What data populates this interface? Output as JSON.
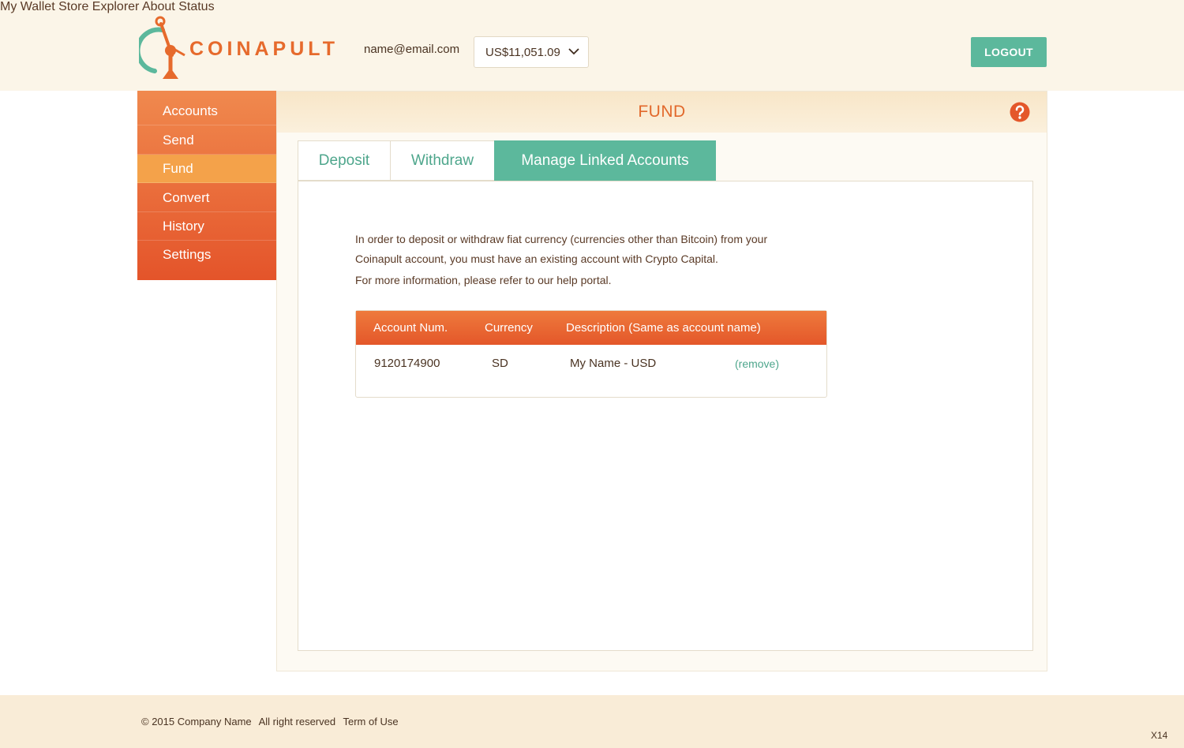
{
  "header": {
    "brand": "COINAPULT",
    "user_email": "name@email.com",
    "balance": "US$11,051.09",
    "nav": [
      "My Wallet",
      "Store",
      "Explorer",
      "About",
      "Status"
    ],
    "logout_label": "LOGOUT"
  },
  "sidebar": {
    "items": [
      {
        "label": "Accounts"
      },
      {
        "label": "Send"
      },
      {
        "label": "Fund",
        "active": true
      },
      {
        "label": "Convert"
      },
      {
        "label": "History"
      },
      {
        "label": "Settings"
      }
    ]
  },
  "panel": {
    "title": "FUND",
    "tabs": [
      {
        "label": "Deposit"
      },
      {
        "label": "Withdraw"
      },
      {
        "label": "Manage Linked Accounts",
        "active": true
      }
    ],
    "info_line1": "In order to deposit or withdraw fiat currency (currencies other than Bitcoin) from your",
    "info_line2": "Coinapult account, you must have an existing account with Crypto Capital.",
    "info_line3": "For more information, please refer to our help portal.",
    "table": {
      "headers": [
        "Account Num.",
        "Currency",
        "Description (Same as account name)"
      ],
      "rows": [
        {
          "account_num": "9120174900",
          "currency": "SD",
          "description": "My Name - USD",
          "action": "(remove)"
        }
      ]
    }
  },
  "footer": {
    "copyright": "© 2015 Company Name",
    "rights": "All right reserved",
    "terms": "Term of Use",
    "version": "X14"
  },
  "colors": {
    "accent_orange": "#e66a2c",
    "accent_green": "#5cb89c",
    "header_bg": "#fbf5e8"
  }
}
